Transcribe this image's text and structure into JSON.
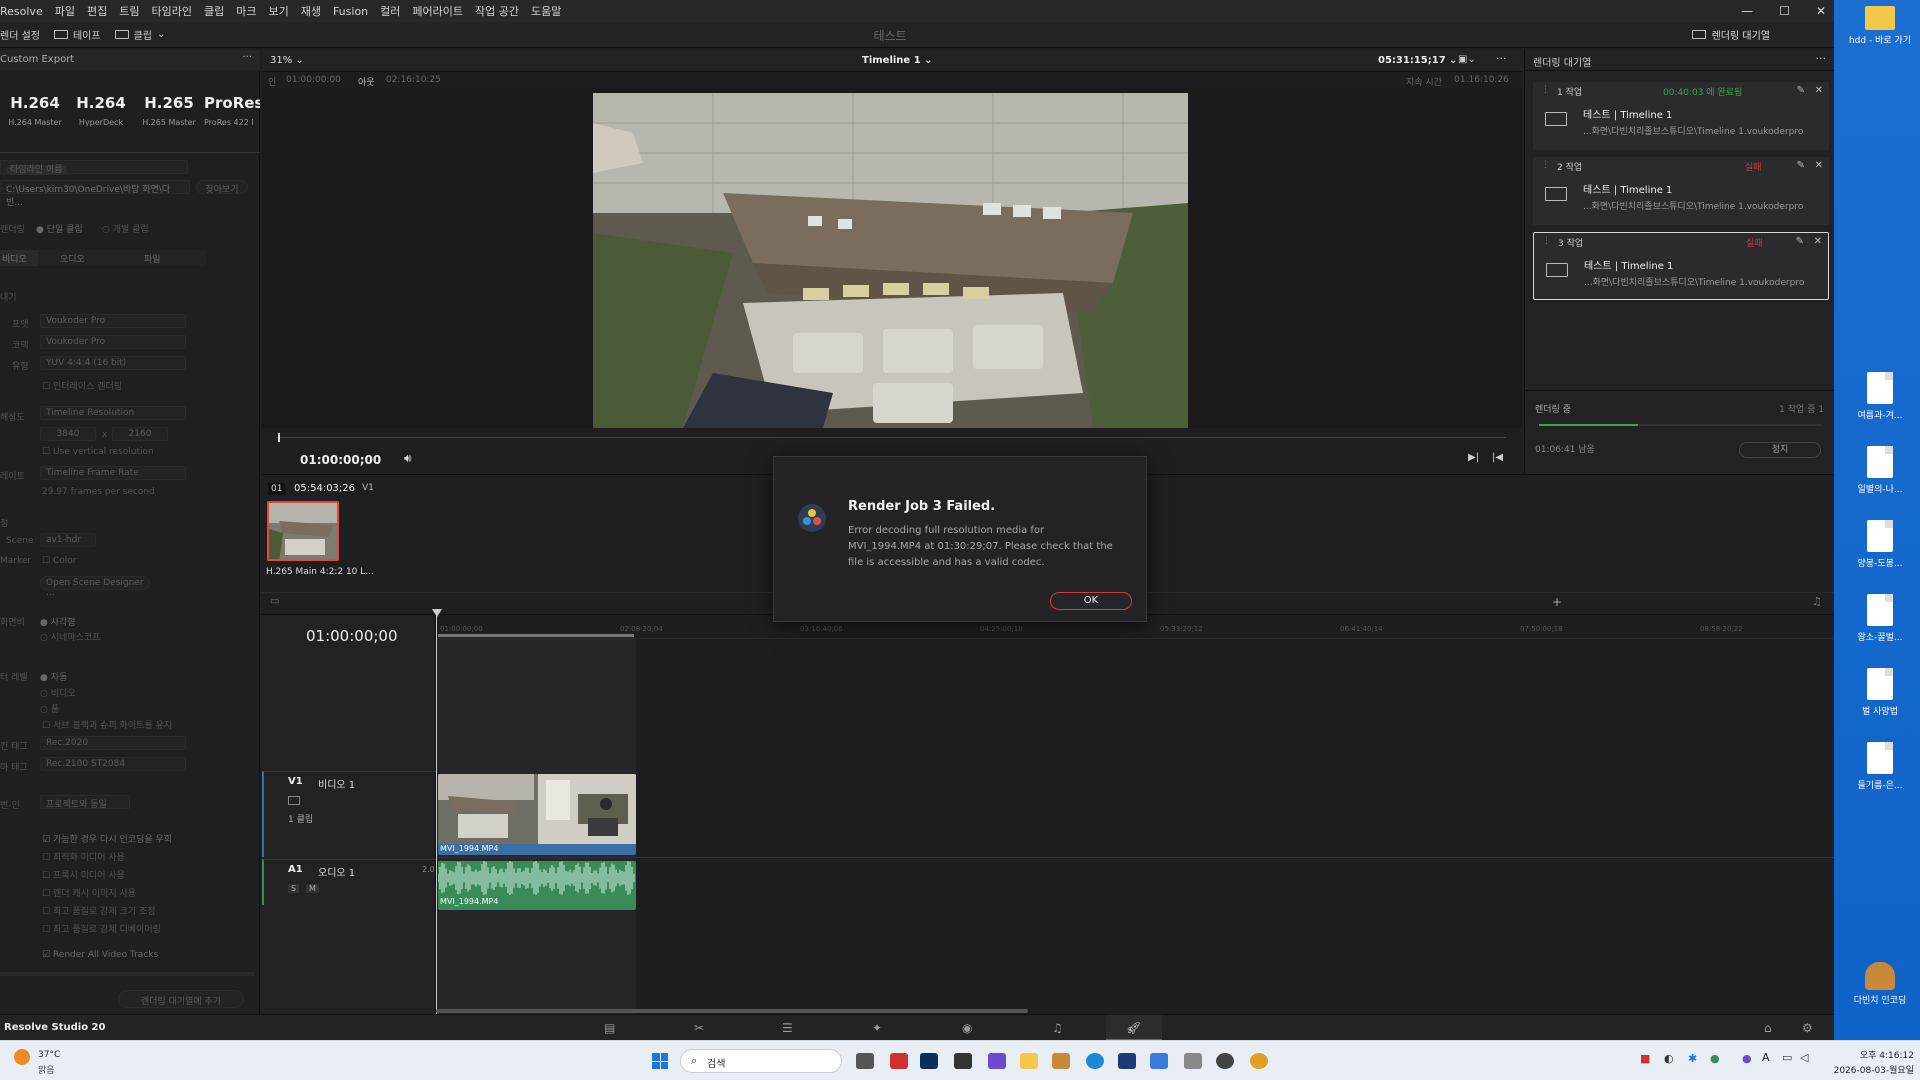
{
  "menu": [
    "Resolve",
    "파일",
    "편집",
    "트림",
    "타임라인",
    "클립",
    "마크",
    "보기",
    "재생",
    "Fusion",
    "컬러",
    "페어라이트",
    "작업 공간",
    "도움말"
  ],
  "toolbar": {
    "render_settings": "렌더 설정",
    "tape": "테이프",
    "clip": "클립",
    "project_title": "테스트",
    "render_queue": "렌더링 대기열"
  },
  "left_panel": {
    "header": "Custom Export",
    "presets": [
      {
        "name": "H.264",
        "sub": "H.264 Master"
      },
      {
        "name": "H.264",
        "sub": "HyperDeck"
      },
      {
        "name": "H.265",
        "sub": "H.265 Master"
      },
      {
        "name": "ProRes",
        "sub": "ProRes 422 I"
      }
    ],
    "filename_label": "타임라인 이름",
    "location": "C:\\Users\\kim30\\OneDrive\\바탕 화면\\다빈...",
    "browse": "찾아보기",
    "render_label": "렌더링",
    "single_clip": "단일 클립",
    "individual_clips": "개별 클립",
    "tabs": [
      "비디오",
      "오디오",
      "파일"
    ],
    "export_label": "내기",
    "format_label": "포맷",
    "format": "Voukoder Pro",
    "codec_label": "코덱",
    "codec": "Voukoder Pro",
    "type_label": "유형",
    "type": "YUV 4:4:4 (16 bit)",
    "interlace": "인터레이스 렌더링",
    "resolution_label": "해상도",
    "resolution": "Timeline Resolution",
    "width": "3840",
    "x": "x",
    "height": "2160",
    "vertical": "Use vertical resolution",
    "framerate_label": "레이트",
    "framerate": "Timeline Frame Rate",
    "fps_text": "29.97 frames per second",
    "section2": "정",
    "scene_label": "Scene",
    "scene": "av1-hdr",
    "marker_label": "Marker",
    "marker": "Color",
    "open_scene": "Open Scene Designer ...",
    "aspect_label": "화면비",
    "square": "사각형",
    "cinemascope": "시네마스코프",
    "data_levels_label": "터 레벨",
    "auto": "자동",
    "video": "비디오",
    "full": "풀",
    "retain": "서브 블랙과 슈퍼 화이트를 유지",
    "color_tag_label": "컨 태그",
    "color_tag": "Rec.2020",
    "gamma_tag_label": "마 태그",
    "gamma_tag": "Rec.2100 ST2084",
    "data_burn_label": "번-인",
    "data_burn": "프로젝트와 동일",
    "options": [
      "가능한 경우 다시 인코딩을 우회",
      "최적화 미디어 사용",
      "프록시 미디어 사용",
      "렌더 캐시 이미지 사용",
      "최고 품질로 강제 크기 조정",
      "최고 품질로 강제 디베이어링"
    ],
    "render_all": "Render All Video Tracks",
    "add_queue": "렌더링 대기열에 추가"
  },
  "viewer": {
    "zoom": "31%",
    "timeline_name": "Timeline 1",
    "timecode_top": "05:31:15;17",
    "in_label": "인",
    "in_tc": "01:00:00:00",
    "out_label": "아웃",
    "out_tc": "02:16:10:25",
    "duration_label": "지속 시간",
    "duration_tc": "01:16:10:26",
    "current_tc": "01:00:00;00"
  },
  "clip_strip": {
    "index": "01",
    "tc": "05:54:03;26",
    "track": "V1",
    "name": "H.265 Main 4:2:2 10 L..."
  },
  "render_queue": {
    "title": "렌더링 대기열",
    "jobs": [
      {
        "label": "1 작업",
        "status": "00:40:03 에 완료됨",
        "status_color": "#3aa84a",
        "title": "테스트 | Timeline 1",
        "path": "...화면\\다빈치리졸브스튜디오\\Timeline 1.voukoderpro"
      },
      {
        "label": "2 작업",
        "status": "실패",
        "status_color": "#d03a3a",
        "title": "테스트 | Timeline 1",
        "path": "...화면\\다빈치리졸브스튜디오\\Timeline 1.voukoderpro"
      },
      {
        "label": "3 작업",
        "status": "실패",
        "status_color": "#d03a3a",
        "title": "테스트 | Timeline 1",
        "path": "...화면\\다빈치리졸브스튜디오\\Timeline 1.voukoderpro"
      }
    ],
    "rendering": "렌더링 중",
    "job_count": "1 작업 중 1",
    "remaining": "01:06:41 남음",
    "stop": "정지",
    "progress": 0.35
  },
  "timeline": {
    "timecode": "01:00:00;00",
    "ruler": [
      "01:00:00;00",
      "02:08:20;04",
      "03:16:40;06",
      "04:25:00;10",
      "05:33:20;12",
      "06:41:40;14",
      "07:50:00;18",
      "08:58:20;22"
    ],
    "v1_label": "V1",
    "v1_name": "비디오 1",
    "v1_clips": "1 클립",
    "a1_label": "A1",
    "a1_name": "오디오 1",
    "a1_ch": "2.0",
    "solo": "S",
    "mute": "M",
    "clip_name": "MVI_1994.MP4"
  },
  "dialog": {
    "title": "Render Job 3 Failed.",
    "message": "Error decoding full resolution media for MVI_1994.MP4 at 01:30:29;07. Please check that the file is accessible and has a valid codec.",
    "ok": "OK"
  },
  "status": {
    "app_name": "Resolve Studio 20"
  },
  "desktop": {
    "icons": [
      "hdd - 바로 가기",
      "여름과-겨...",
      "일별의-나...",
      "양봉-도봉...",
      "왕소-꿀벌...",
      "벌 사양법",
      "들기름-은...",
      "다빈치 인코딩"
    ]
  },
  "taskbar": {
    "weather_temp": "37°C",
    "weather_state": "맑음",
    "search": "검색",
    "time": "오후 4:16:12",
    "date": "2026-08-03-월요일",
    "ime": "A"
  }
}
